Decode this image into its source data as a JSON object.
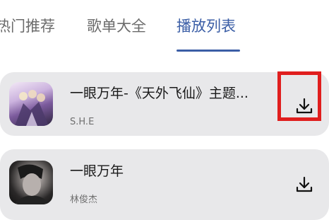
{
  "tabs": [
    {
      "label": "热门推荐"
    },
    {
      "label": "歌单大全"
    },
    {
      "label": "播放列表"
    }
  ],
  "active_tab": "播放列表",
  "playlist": [
    {
      "title": "一眼万年-《天外飞仙》主题...",
      "artist": "S.H.E",
      "cover_icon": "album-cover"
    },
    {
      "title": "一眼万年",
      "artist": "林俊杰",
      "cover_icon": "album-cover"
    }
  ],
  "colors": {
    "accent": "#3b5ea6",
    "card_bg": "#e8e8ea",
    "highlight": "#e01e1e"
  }
}
